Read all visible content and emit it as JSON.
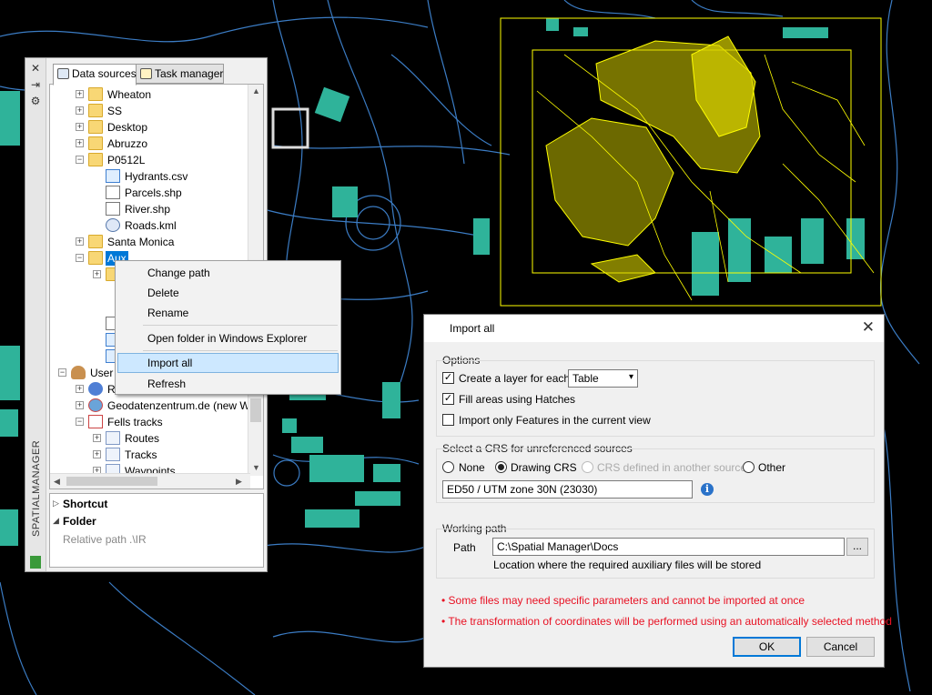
{
  "colors": {
    "accent": "#0078d7",
    "map_background": "#000000",
    "map_roads": "#3b7cc4",
    "map_buildings": "#2fb39a",
    "map_selection": "#ffff00",
    "warning_text": "#e81123"
  },
  "palette": {
    "side_title": "SPATIALMANAGER",
    "tabs": [
      {
        "label": "Data sources",
        "icon": "data-sources-icon",
        "active": true
      },
      {
        "label": "Task manager",
        "icon": "task-manager-icon",
        "active": false
      }
    ],
    "tree": [
      {
        "label": "Wheaton",
        "icon": "folder-icon"
      },
      {
        "label": "SS",
        "icon": "folder-icon"
      },
      {
        "label": "Desktop",
        "icon": "folder-icon"
      },
      {
        "label": "Abruzzo",
        "icon": "folder-icon"
      },
      {
        "label": "P0512L",
        "icon": "folder-icon"
      },
      {
        "label": "Hydrants.csv",
        "icon": "csv-icon"
      },
      {
        "label": "Parcels.shp",
        "icon": "shapefile-icon"
      },
      {
        "label": "River.shp",
        "icon": "shapefile-icon"
      },
      {
        "label": "Roads.kml",
        "icon": "kml-icon"
      },
      {
        "label": "Santa Monica",
        "icon": "folder-icon"
      },
      {
        "label": "Aux",
        "icon": "folder-icon",
        "selected": true
      },
      {
        "label": "User d",
        "icon": "user-icon"
      },
      {
        "label": "Ro",
        "icon": "geoserver-icon"
      },
      {
        "label": "Geodatenzentrum.de (new W",
        "icon": "wfs-icon"
      },
      {
        "label": "Fells tracks",
        "icon": "tracks-icon"
      },
      {
        "label": "Routes",
        "icon": "table-icon"
      },
      {
        "label": "Tracks",
        "icon": "table-icon"
      },
      {
        "label": "Waypoints",
        "icon": "table-icon"
      }
    ],
    "properties": {
      "shortcut_header": "Shortcut",
      "folder_header": "Folder",
      "relative_path_label": "Relative path",
      "relative_path_value": ".\\IR"
    }
  },
  "context_menu": {
    "items": [
      "Change path",
      "Delete",
      "Rename",
      "Open folder in Windows Explorer",
      "Import all",
      "Refresh"
    ],
    "highlighted": "Import all"
  },
  "dialog": {
    "title": "Import all",
    "options": {
      "group_label": "Options",
      "create_layer_label": "Create a layer for each",
      "create_layer_checked": true,
      "create_layer_select": "Table",
      "fill_hatches_label": "Fill areas using Hatches",
      "fill_hatches_checked": true,
      "import_view_label": "Import only Features in the current view",
      "import_view_checked": false
    },
    "crs": {
      "group_label": "Select a CRS for unreferenced sources",
      "radios": [
        "None",
        "Drawing CRS",
        "CRS defined in another source",
        "Other"
      ],
      "selected": "Drawing CRS",
      "value": "ED50 / UTM zone 30N (23030)"
    },
    "working_path": {
      "group_label": "Working path",
      "path_label": "Path",
      "path_value": "C:\\Spatial Manager\\Docs",
      "browse_label": "...",
      "hint": "Location where the required auxiliary files will be stored"
    },
    "notes": [
      "• Some files may need specific parameters and cannot be imported at once",
      "• The transformation of coordinates will be performed using an automatically selected method"
    ],
    "ok_label": "OK",
    "cancel_label": "Cancel",
    "close_label": "✕"
  }
}
